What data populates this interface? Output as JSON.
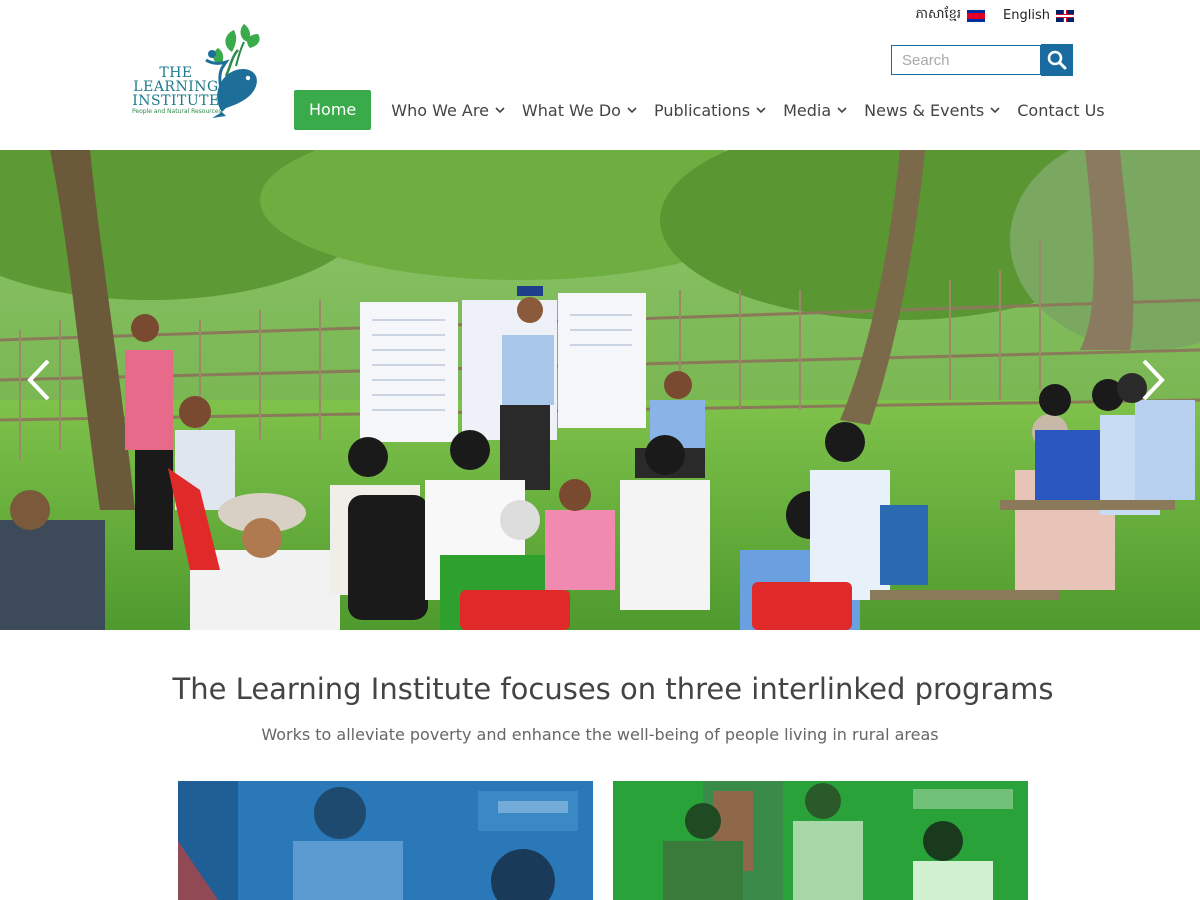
{
  "header": {
    "logo": {
      "line1": "THE",
      "line2": "LEARNING",
      "line3": "INSTITUTE",
      "tagline": "People and Natural Resources",
      "icon": "fish-plant-logo-icon"
    },
    "languages": [
      {
        "label": "ភាសាខ្មែរ",
        "flag": "cambodia-flag-icon"
      },
      {
        "label": "English",
        "flag": "uk-flag-icon"
      }
    ],
    "search": {
      "placeholder": "Search",
      "value": "",
      "button_icon": "search-icon"
    },
    "nav": [
      {
        "label": "Home",
        "active": true
      },
      {
        "label": "Who We Are",
        "dropdown": true
      },
      {
        "label": "What We Do",
        "dropdown": true
      },
      {
        "label": "Publications",
        "dropdown": true
      },
      {
        "label": "Media",
        "dropdown": true
      },
      {
        "label": "News & Events",
        "dropdown": true
      },
      {
        "label": "Contact Us",
        "dropdown": false
      }
    ]
  },
  "hero": {
    "prev_icon": "chevron-left-icon",
    "next_icon": "chevron-right-icon"
  },
  "programs": {
    "title": "The Learning Institute focuses on three interlinked programs",
    "subtitle": "Works to alleviate poverty and enhance the well-being of people living in rural areas"
  },
  "colors": {
    "brand_green": "#3aab4a",
    "brand_blue": "#1a6ca0",
    "text": "#444444",
    "card_blue_tint": "#1f6fb0",
    "card_green_tint": "#2aa23a"
  }
}
